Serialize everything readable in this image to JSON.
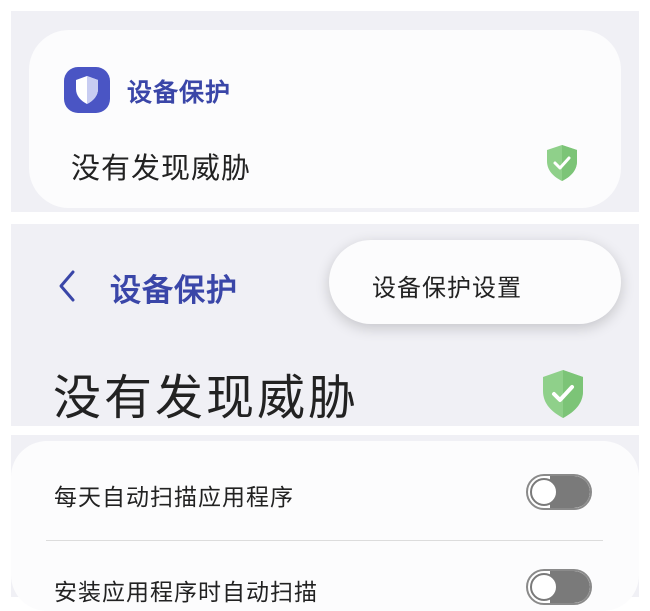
{
  "top_card": {
    "title": "设备保护",
    "status": "没有发现威胁"
  },
  "header": {
    "title": "设备保护"
  },
  "popup_menu": {
    "items": [
      "设备保护设置"
    ]
  },
  "status": {
    "text": "没有发现威胁"
  },
  "settings": {
    "rows": [
      {
        "label": "每天自动扫描应用程序",
        "enabled": false
      },
      {
        "label": "安装应用程序时自动扫描",
        "enabled": false
      }
    ]
  },
  "colors": {
    "accent": "#3a46a8",
    "icon_bg": "#4a55c4",
    "shield_green": "#8fd08a",
    "panel_bg": "#f0f0f5"
  },
  "icons": [
    "shield-icon",
    "shield-check-icon",
    "chevron-left-icon",
    "toggle-switch"
  ]
}
